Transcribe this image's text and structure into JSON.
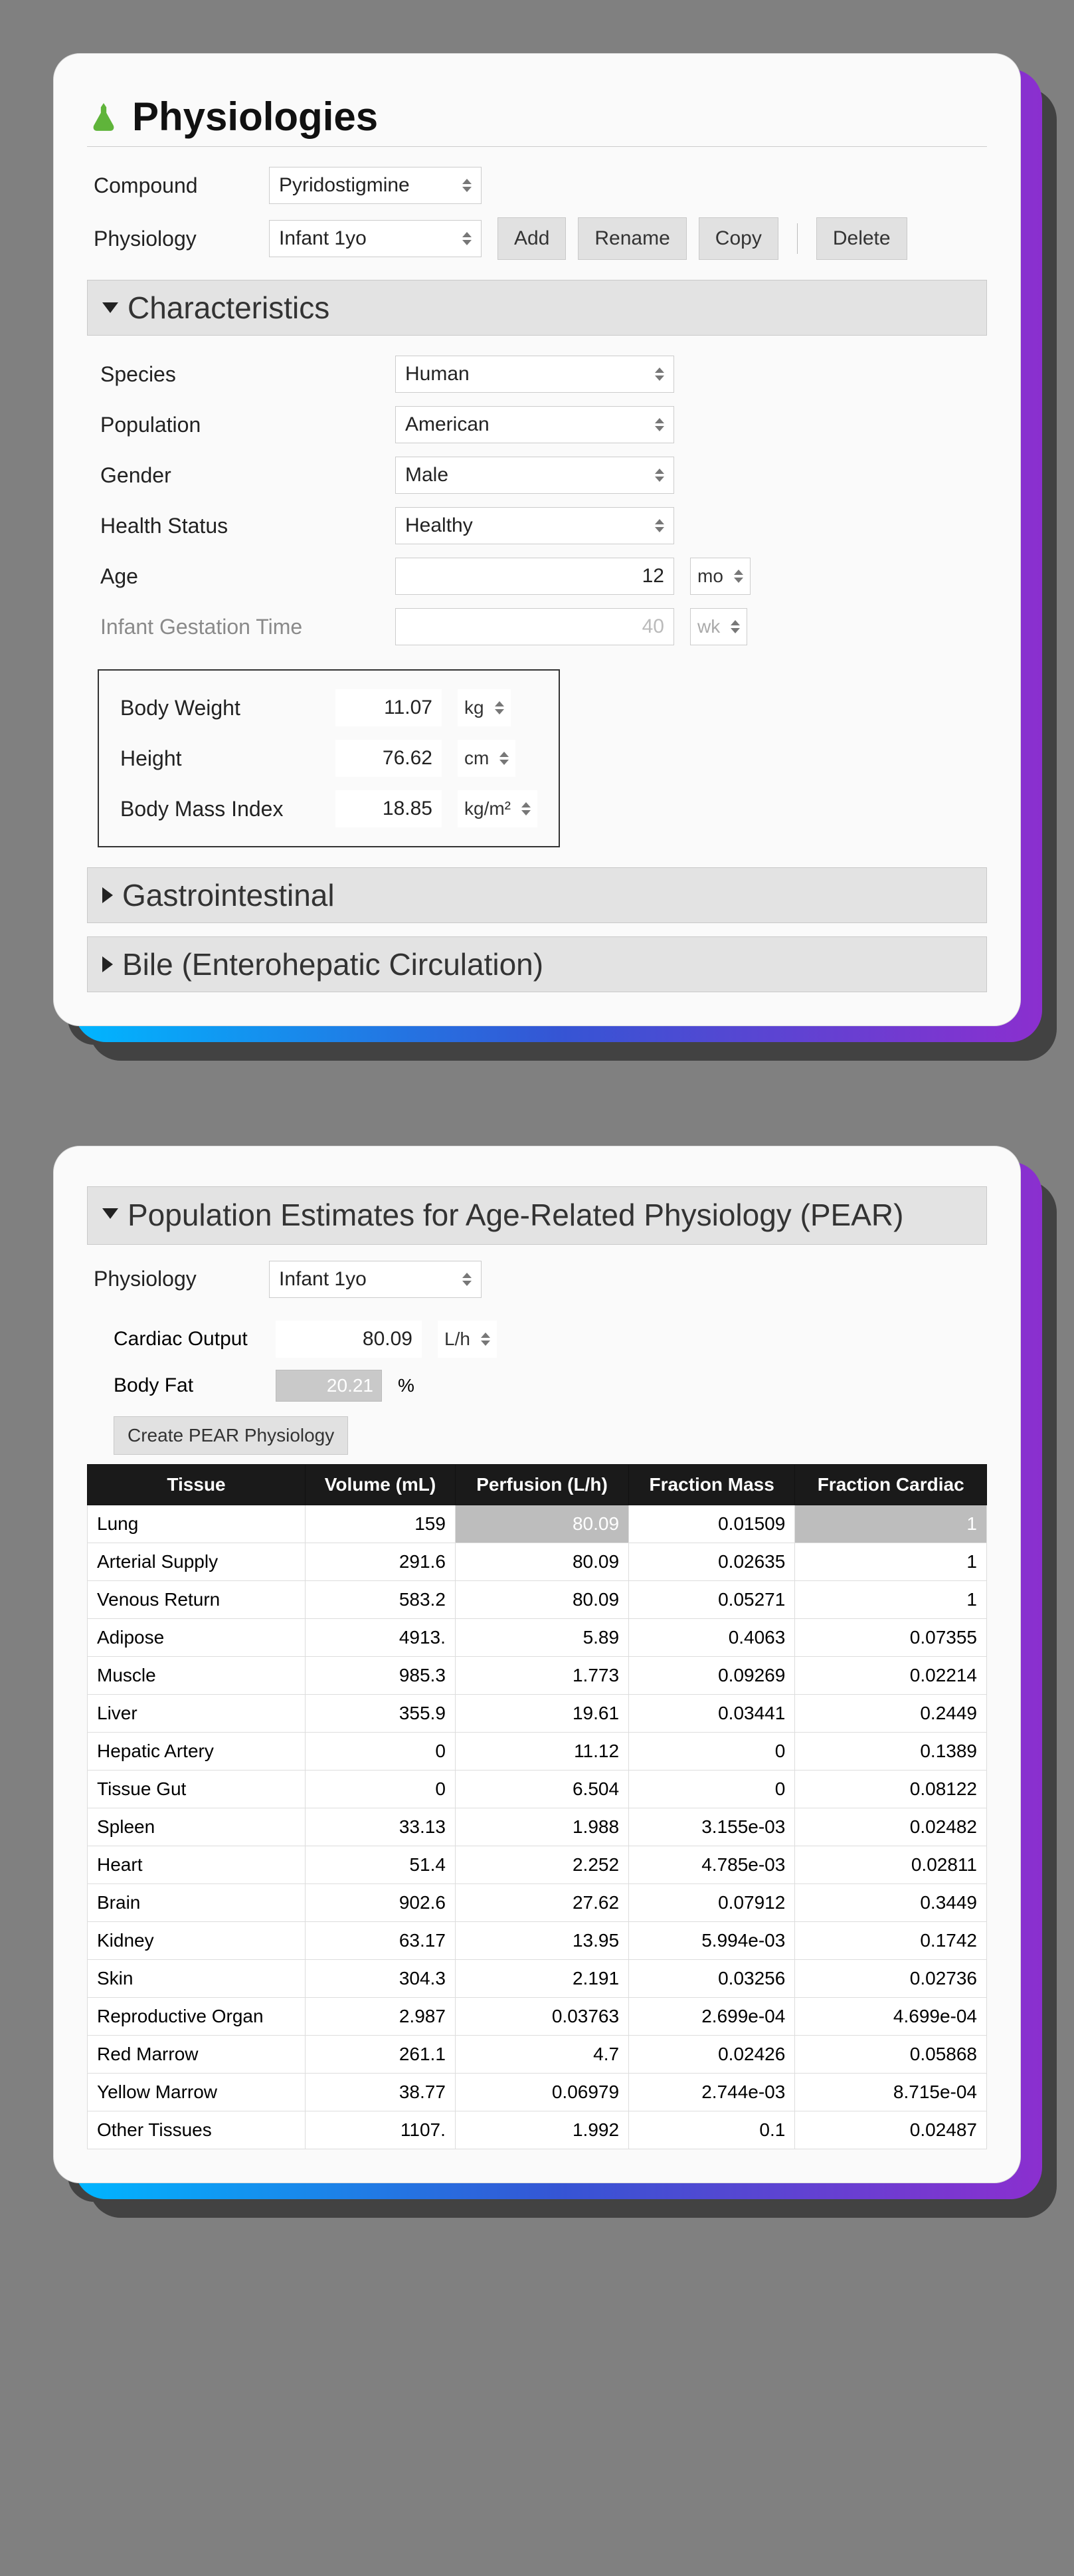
{
  "panel1": {
    "title": "Physiologies",
    "compound": {
      "label": "Compound",
      "value": "Pyridostigmine"
    },
    "physiology": {
      "label": "Physiology",
      "value": "Infant 1yo"
    },
    "buttons": {
      "add": "Add",
      "rename": "Rename",
      "copy": "Copy",
      "delete": "Delete"
    },
    "sec_char": "Characteristics",
    "sec_gi": "Gastrointestinal",
    "sec_bile": "Bile (Enterohepatic Circulation)",
    "char": {
      "species": {
        "label": "Species",
        "value": "Human"
      },
      "population": {
        "label": "Population",
        "value": "American"
      },
      "gender": {
        "label": "Gender",
        "value": "Male"
      },
      "health": {
        "label": "Health Status",
        "value": "Healthy"
      },
      "age": {
        "label": "Age",
        "value": "12",
        "unit": "mo"
      },
      "gestation": {
        "label": "Infant Gestation Time",
        "value": "40",
        "unit": "wk"
      },
      "body_weight": {
        "label": "Body Weight",
        "value": "11.07",
        "unit": "kg"
      },
      "height": {
        "label": "Height",
        "value": "76.62",
        "unit": "cm"
      },
      "bmi": {
        "label": "Body Mass Index",
        "value": "18.85",
        "unit": "kg/m²"
      }
    }
  },
  "panel2": {
    "title": "Population Estimates for Age-Related Physiology (PEAR)",
    "physiology": {
      "label": "Physiology",
      "value": "Infant 1yo"
    },
    "cardiac": {
      "label": "Cardiac Output",
      "value": "80.09",
      "unit": "L/h"
    },
    "bodyfat": {
      "label": "Body Fat",
      "value": "20.21",
      "unit": "%"
    },
    "create_btn": "Create PEAR Physiology",
    "table": {
      "headers": [
        "Tissue",
        "Volume (mL)",
        "Perfusion (L/h)",
        "Fraction Mass",
        "Fraction Cardiac"
      ],
      "rows": [
        {
          "tissue": "Lung",
          "vol": "159",
          "perf": "80.09",
          "fmass": "0.01509",
          "fcard": "1",
          "hl": true
        },
        {
          "tissue": "Arterial Supply",
          "vol": "291.6",
          "perf": "80.09",
          "fmass": "0.02635",
          "fcard": "1"
        },
        {
          "tissue": "Venous Return",
          "vol": "583.2",
          "perf": "80.09",
          "fmass": "0.05271",
          "fcard": "1"
        },
        {
          "tissue": "Adipose",
          "vol": "4913.",
          "perf": "5.89",
          "fmass": "0.4063",
          "fcard": "0.07355"
        },
        {
          "tissue": "Muscle",
          "vol": "985.3",
          "perf": "1.773",
          "fmass": "0.09269",
          "fcard": "0.02214"
        },
        {
          "tissue": "Liver",
          "vol": "355.9",
          "perf": "19.61",
          "fmass": "0.03441",
          "fcard": "0.2449"
        },
        {
          "tissue": "Hepatic Artery",
          "vol": "0",
          "perf": "11.12",
          "fmass": "0",
          "fcard": "0.1389"
        },
        {
          "tissue": "Tissue Gut",
          "vol": "0",
          "perf": "6.504",
          "fmass": "0",
          "fcard": "0.08122"
        },
        {
          "tissue": "Spleen",
          "vol": "33.13",
          "perf": "1.988",
          "fmass": "3.155e-03",
          "fcard": "0.02482"
        },
        {
          "tissue": "Heart",
          "vol": "51.4",
          "perf": "2.252",
          "fmass": "4.785e-03",
          "fcard": "0.02811"
        },
        {
          "tissue": "Brain",
          "vol": "902.6",
          "perf": "27.62",
          "fmass": "0.07912",
          "fcard": "0.3449"
        },
        {
          "tissue": "Kidney",
          "vol": "63.17",
          "perf": "13.95",
          "fmass": "5.994e-03",
          "fcard": "0.1742"
        },
        {
          "tissue": "Skin",
          "vol": "304.3",
          "perf": "2.191",
          "fmass": "0.03256",
          "fcard": "0.02736"
        },
        {
          "tissue": "Reproductive Organ",
          "vol": "2.987",
          "perf": "0.03763",
          "fmass": "2.699e-04",
          "fcard": "4.699e-04"
        },
        {
          "tissue": "Red Marrow",
          "vol": "261.1",
          "perf": "4.7",
          "fmass": "0.02426",
          "fcard": "0.05868"
        },
        {
          "tissue": "Yellow Marrow",
          "vol": "38.77",
          "perf": "0.06979",
          "fmass": "2.744e-03",
          "fcard": "8.715e-04"
        },
        {
          "tissue": "Other Tissues",
          "vol": "1107.",
          "perf": "1.992",
          "fmass": "0.1",
          "fcard": "0.02487"
        }
      ]
    }
  }
}
